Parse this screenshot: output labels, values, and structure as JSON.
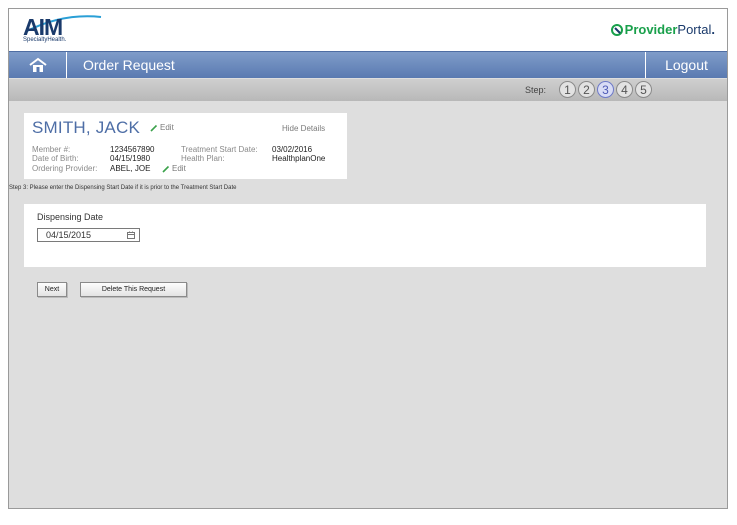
{
  "brand": {
    "aim_logo_text": "AIM",
    "aim_logo_subtext": "SpecialtyHealth.",
    "portal_logo_part1": "Provider",
    "portal_logo_part2": "Portal",
    "portal_logo_dot": "."
  },
  "nav": {
    "title": "Order Request",
    "logout_label": "Logout"
  },
  "steps": {
    "label": "Step:",
    "items": [
      "1",
      "2",
      "3",
      "4",
      "5"
    ],
    "active": 3
  },
  "patient": {
    "name": "SMITH, JACK",
    "edit_label": "Edit",
    "hide_details_label": "Hide Details",
    "member_label": "Member #:",
    "member_value": "1234567890",
    "dob_label": "Date of Birth:",
    "dob_value": "04/15/1980",
    "ordering_provider_label": "Ordering Provider:",
    "ordering_provider_value": "ABEL, JOE",
    "provider_edit_label": "Edit",
    "treatment_start_label": "Treatment Start Date:",
    "treatment_start_value": "03/02/2016",
    "health_plan_label": "Health Plan:",
    "health_plan_value": "HealthplanOne"
  },
  "instructions": "Step 3:  Please enter the Dispensing Start Date if it is prior to the Treatment Start Date",
  "dispensing": {
    "label": "Dispensing Date",
    "value": "04/15/2015"
  },
  "actions": {
    "next_label": "Next",
    "delete_label": "Delete This Request"
  },
  "colors": {
    "nav_blue": "#5a7ab1",
    "name_blue": "#4e6ea6",
    "portal_green": "#19a04b",
    "active_step": "#4d59b5"
  }
}
